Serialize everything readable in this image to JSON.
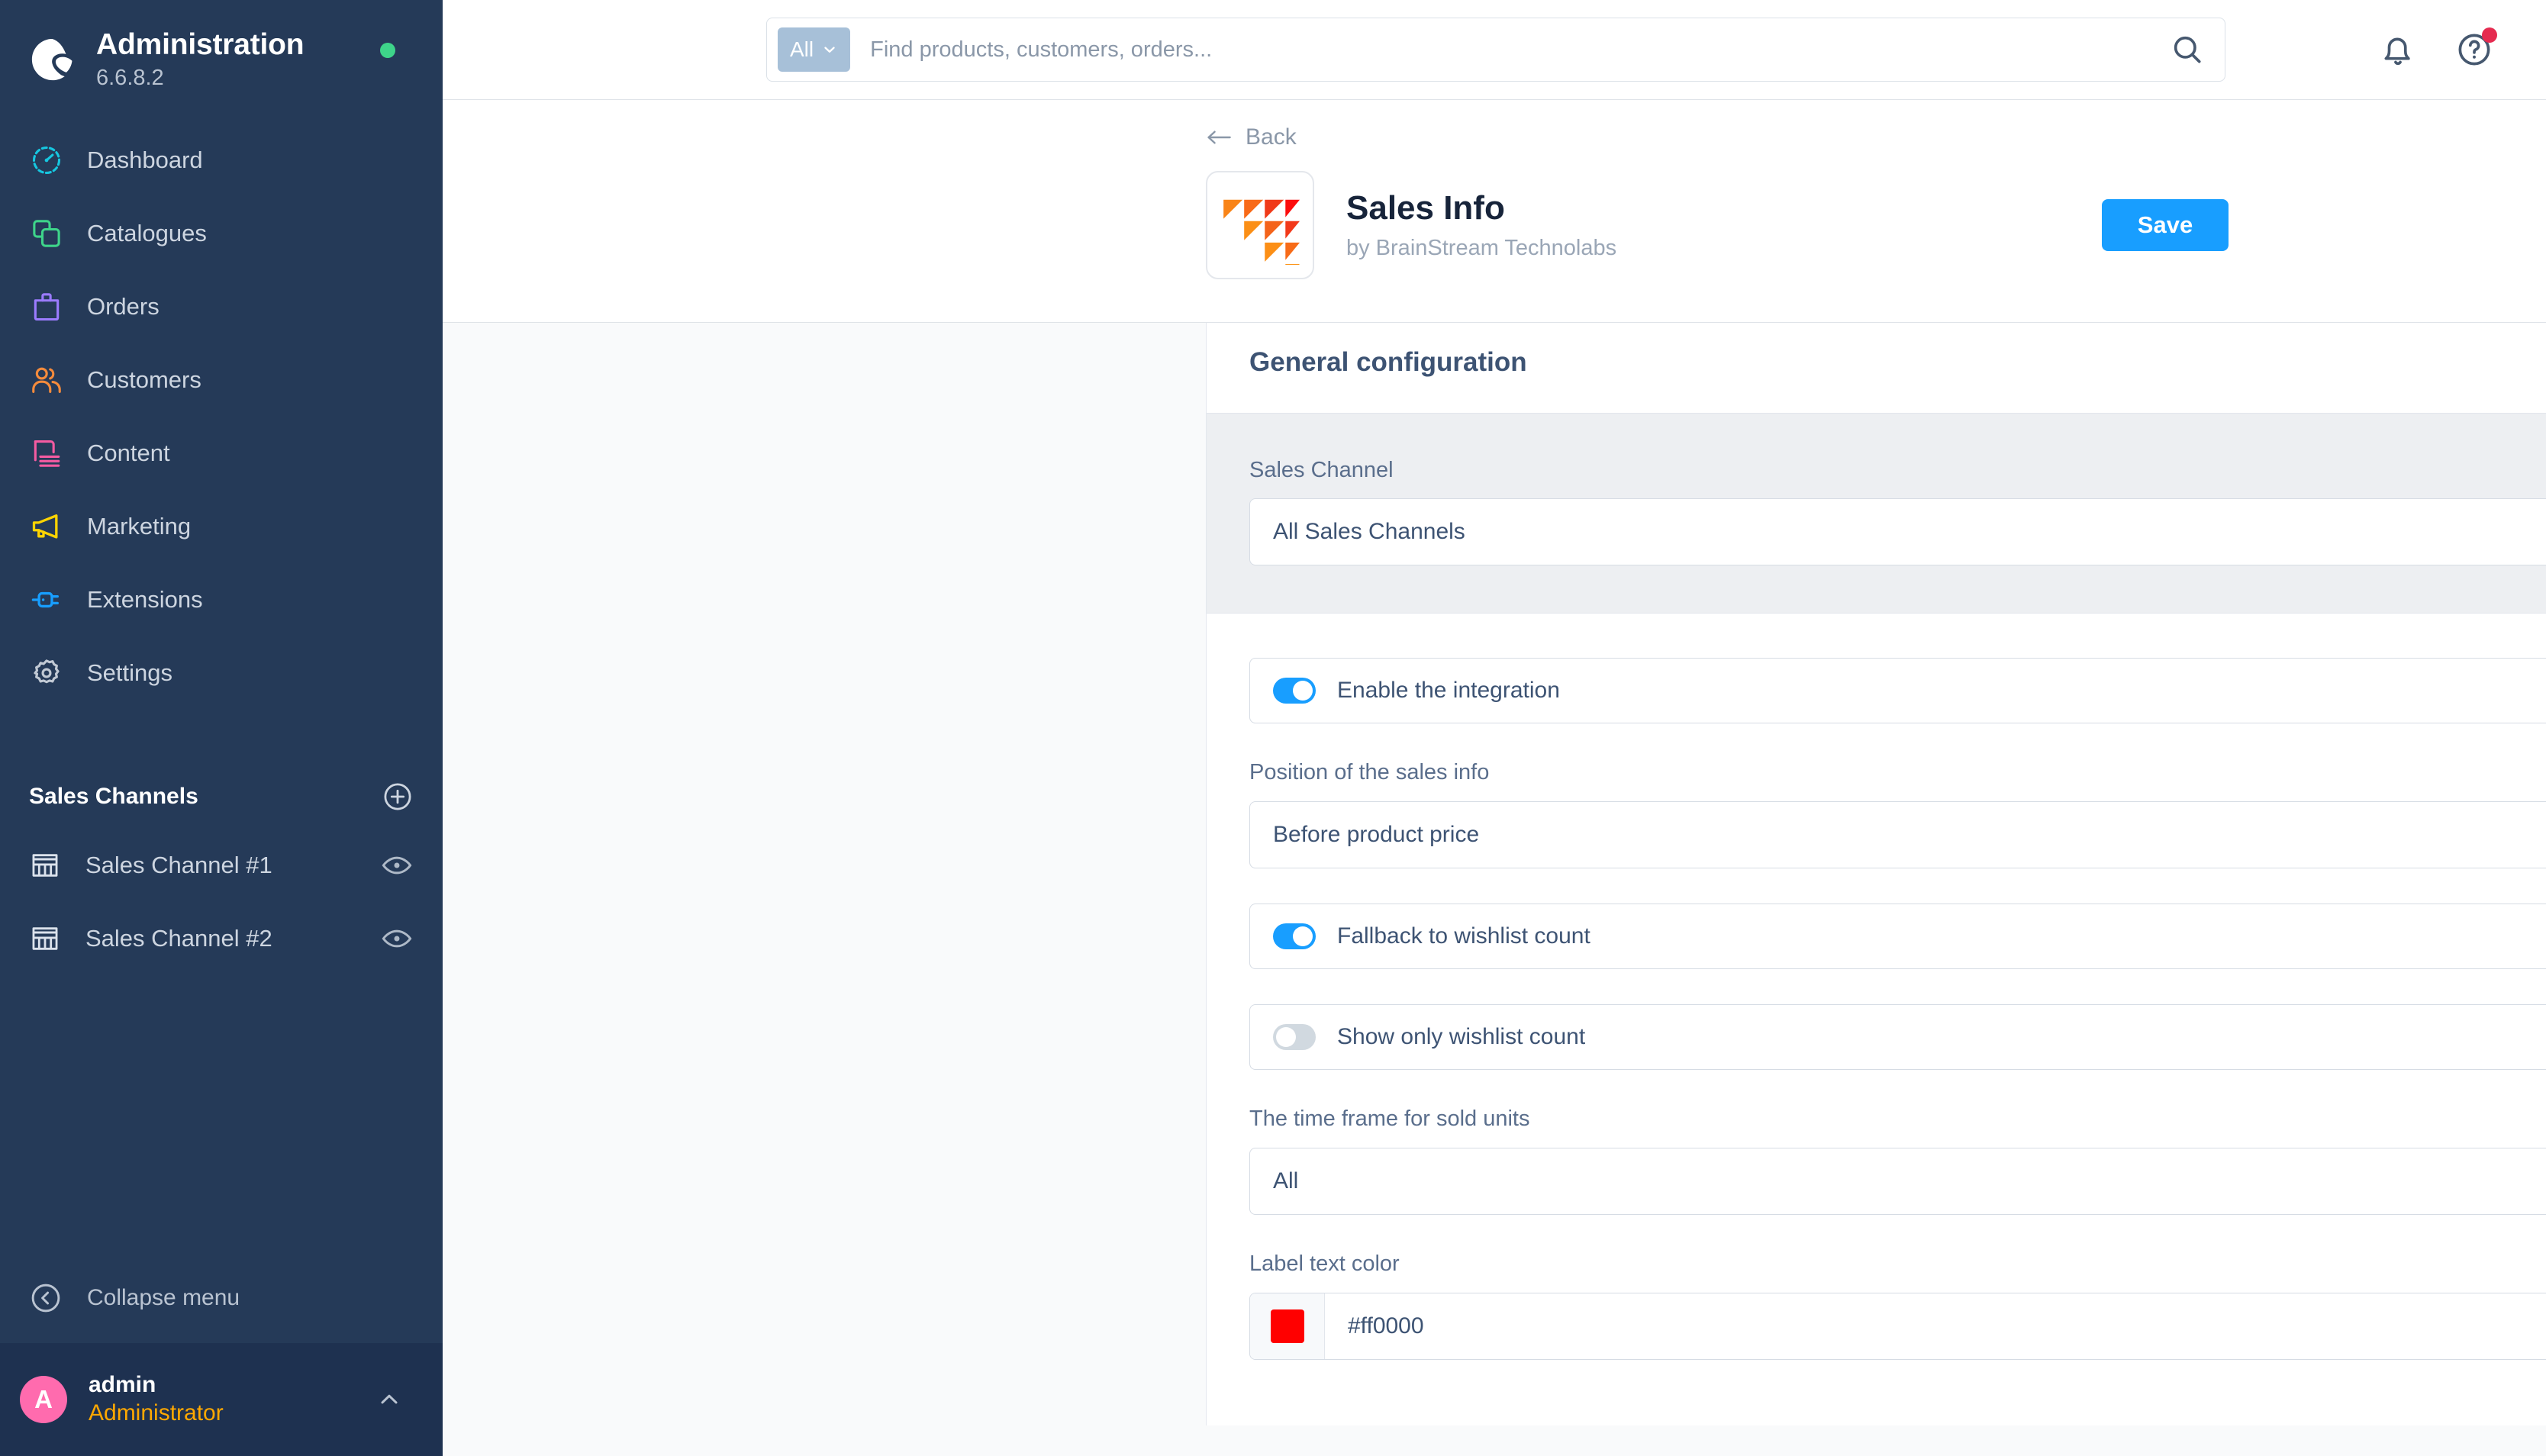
{
  "brand": {
    "title": "Administration",
    "version": "6.6.8.2",
    "logo_icon": "shopware-logo-icon",
    "status_dot_color": "#3ed48a"
  },
  "sidebar": {
    "nav_items": [
      {
        "label": "Dashboard",
        "icon": "dashboard-gauge-icon",
        "color": "#16c7e0"
      },
      {
        "label": "Catalogues",
        "icon": "catalogues-copy-icon",
        "color": "#3ed48a"
      },
      {
        "label": "Orders",
        "icon": "orders-bag-icon",
        "color": "#9b7bff"
      },
      {
        "label": "Customers",
        "icon": "customers-people-icon",
        "color": "#f58b3c"
      },
      {
        "label": "Content",
        "icon": "content-page-icon",
        "color": "#f45ba1"
      },
      {
        "label": "Marketing",
        "icon": "marketing-megaphone-icon",
        "color": "#ffd400"
      },
      {
        "label": "Extensions",
        "icon": "extensions-plug-icon",
        "color": "#189eff"
      },
      {
        "label": "Settings",
        "icon": "settings-gear-icon",
        "color": "#c1c9d4"
      }
    ],
    "section": {
      "title": "Sales Channels",
      "add_icon": "plus-circle-icon"
    },
    "channels": [
      {
        "label": "Sales Channel #1",
        "icon": "storefront-icon",
        "action_icon": "eye-icon"
      },
      {
        "label": "Sales Channel #2",
        "icon": "storefront-icon",
        "action_icon": "eye-icon"
      }
    ],
    "collapse": {
      "label": "Collapse menu",
      "icon": "collapse-left-circle-icon"
    },
    "user": {
      "avatar_initial": "A",
      "avatar_color": "#ff6bae",
      "name": "admin",
      "role": "Administrator",
      "role_color": "#ffa800",
      "caret_icon": "chevron-up-icon"
    }
  },
  "topbar": {
    "search": {
      "scope_label": "All",
      "scope_caret_icon": "chevron-down-icon",
      "placeholder": "Find products, customers, orders...",
      "value": "",
      "search_icon": "search-icon"
    },
    "notifications_icon": "bell-icon",
    "help_icon": "help-circle-icon",
    "help_has_badge": true,
    "badge_color": "#e52b50"
  },
  "page_header": {
    "back_label": "Back",
    "back_icon": "arrow-left-icon",
    "app_logo_icon": "sales-info-triangles-logo",
    "title": "Sales Info",
    "subtitle": "by BrainStream Technolabs",
    "save_label": "Save",
    "save_color": "#189eff"
  },
  "config": {
    "section_title": "General configuration",
    "sales_channel": {
      "label": "Sales Channel",
      "value": "All Sales Channels",
      "caret_icon": "chevron-down-icon"
    },
    "fields": [
      {
        "kind": "toggle",
        "label": "Enable the integration",
        "on": true,
        "help_icon": "help-circle-icon"
      },
      {
        "kind": "select",
        "label": "Position of the sales info",
        "value": "Before product price",
        "caret_icon": "chevron-down-icon",
        "help_icon": "help-circle-icon"
      },
      {
        "kind": "toggle",
        "label": "Fallback to wishlist count",
        "on": true,
        "help_icon": "help-circle-icon"
      },
      {
        "kind": "toggle",
        "label": "Show only wishlist count",
        "on": false,
        "help_icon": "help-circle-icon"
      },
      {
        "kind": "select",
        "label": "The time frame for sold units",
        "value": "All",
        "caret_icon": "chevron-down-icon",
        "help_icon": "help-circle-icon"
      },
      {
        "kind": "color",
        "label": "Label text color",
        "value": "#ff0000",
        "swatch_color": "#ff0000",
        "help_icon": "help-circle-icon"
      }
    ]
  }
}
